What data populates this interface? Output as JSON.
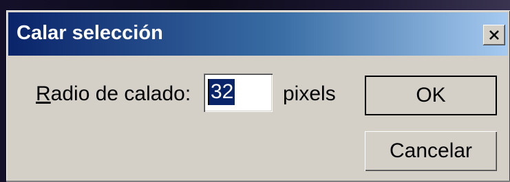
{
  "dialog": {
    "title": "Calar selección",
    "close_icon": "close-icon"
  },
  "form": {
    "label_accel": "R",
    "label_rest": "adio de calado:",
    "value": "32",
    "units": "pixels"
  },
  "buttons": {
    "ok_label": "OK",
    "cancel_label": "Cancelar"
  },
  "colors": {
    "title_start": "#0a246a",
    "title_end": "#a6caf0",
    "dialog_bg": "#d4d0c8",
    "selection": "#0a246a"
  }
}
